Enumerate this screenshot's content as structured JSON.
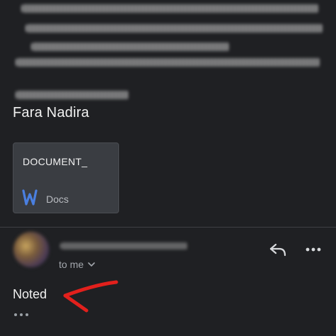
{
  "sender": {
    "name": "Fara Nadira"
  },
  "attachment": {
    "title": "DOCUMENT_",
    "type_label": "Docs",
    "icon": "word-doc-icon"
  },
  "reply": {
    "recipient_label": "to me",
    "body": "Noted",
    "icons": {
      "reply": "reply-icon",
      "more": "more-horizontal-icon",
      "trimmed": "show-trimmed-content-icon",
      "expand": "chevron-down-icon"
    }
  },
  "annotation": {
    "arrow_color": "#e2201c"
  }
}
